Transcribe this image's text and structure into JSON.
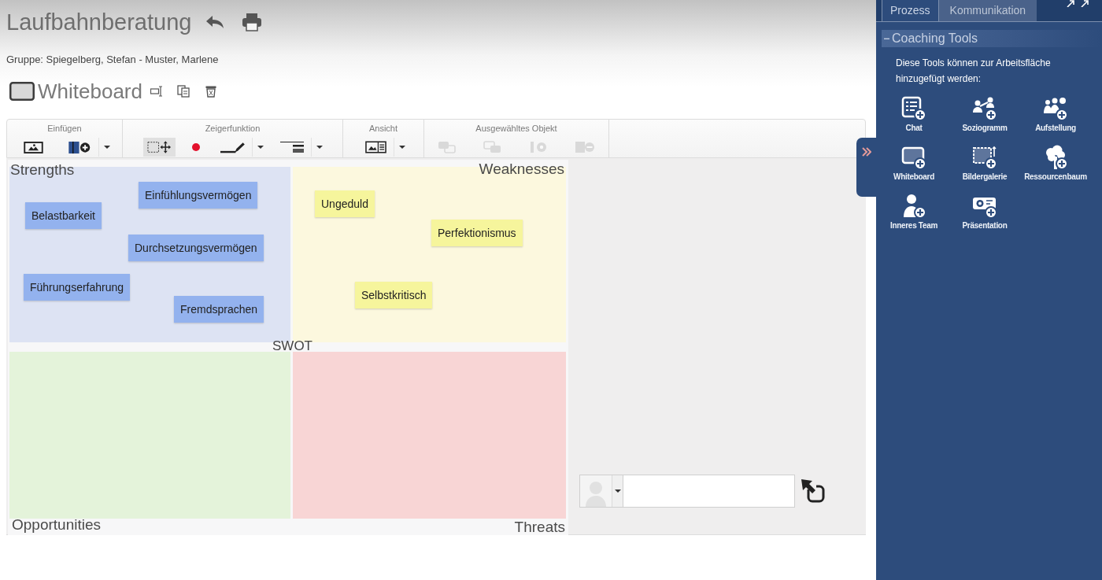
{
  "header": {
    "title": "Laufbahnberatung",
    "group": "Gruppe: Spiegelberg, Stefan - Muster, Marlene"
  },
  "whiteboard": {
    "title": "Whiteboard"
  },
  "toolbar": {
    "groups": [
      {
        "label": "Einfügen",
        "tools": [
          {
            "dropdown": false
          },
          {
            "dropdown": true
          }
        ]
      },
      {
        "label": "Zeigerfunktion",
        "tools": [
          {
            "selected": true,
            "dropdown": false
          },
          {
            "selected": false,
            "dropdown": false
          },
          {
            "selected": false,
            "dropdown": true
          },
          {
            "selected": false,
            "dropdown": true
          }
        ]
      },
      {
        "label": "Ansicht",
        "tools": [
          {
            "dropdown": true
          }
        ]
      },
      {
        "label": "Ausgewähltes Objekt",
        "tools": [
          {
            "disabled": true
          },
          {
            "disabled": true
          },
          {
            "disabled": true
          },
          {
            "disabled": true
          }
        ]
      }
    ]
  },
  "swot": {
    "title": "SWOT",
    "quadrants": [
      {
        "label": "Strengths",
        "color": "#dde3f3",
        "notes": [
          "Einfühlungsvermögen",
          "Belastbarkeit",
          "Durchsetzungsvermögen",
          "Führungserfahrung",
          "Fremdsprachen"
        ]
      },
      {
        "label": "Weaknesses",
        "color": "#fcf8de",
        "notes": [
          "Ungeduld",
          "Perfektionismus",
          "Selbstkritisch"
        ]
      },
      {
        "label": "Opportunities",
        "color": "#e4f3da"
      },
      {
        "label": "Threats",
        "color": "#f8d5d5"
      }
    ]
  },
  "sidebar": {
    "tabs": [
      {
        "label": "Prozess",
        "selected": true
      },
      {
        "label": "Kommunikation",
        "selected": false
      }
    ],
    "section": {
      "title": "Coaching Tools",
      "expanded": true,
      "description": "Diese Tools können zur Arbeitsfläche hinzugefügt werden:",
      "tools": [
        "Chat",
        "Soziogramm",
        "Aufstellung",
        "Whiteboard",
        "Bildergalerie",
        "Ressourcenbaum",
        "Inneres Team",
        "Präsentation"
      ]
    }
  }
}
